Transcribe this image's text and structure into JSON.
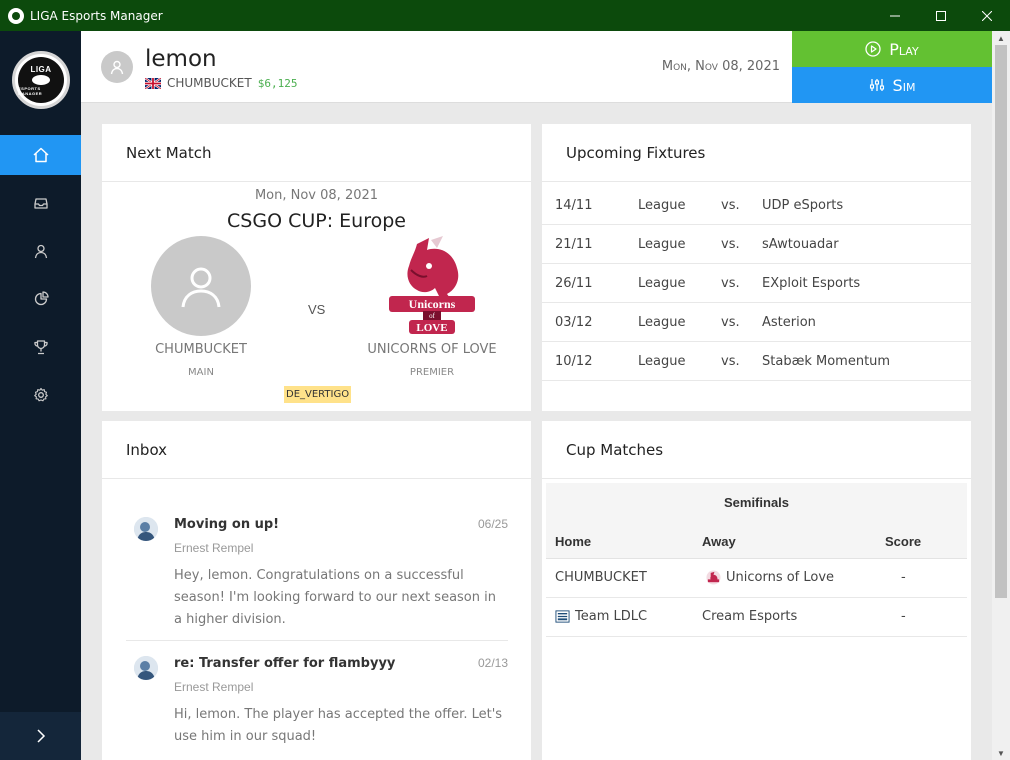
{
  "window": {
    "title": "LIGA Esports Manager"
  },
  "logo": {
    "top_text": "LIGA",
    "bottom_text": "ESPORTS MANAGER"
  },
  "header": {
    "username": "lemon",
    "team": "CHUMBUCKET",
    "money": "$6,125",
    "date": "Mon, Nov 08, 2021",
    "play_label": "Play",
    "sim_label": "Sim"
  },
  "sidebar": {
    "items": [
      {
        "icon": "home-icon",
        "active": true
      },
      {
        "icon": "inbox-icon",
        "active": false
      },
      {
        "icon": "user-icon",
        "active": false
      },
      {
        "icon": "pie-chart-icon",
        "active": false
      },
      {
        "icon": "trophy-icon",
        "active": false
      },
      {
        "icon": "gear-icon",
        "active": false
      }
    ]
  },
  "next_match": {
    "title": "Next Match",
    "date": "Mon, Nov 08, 2021",
    "competition": "CSGO CUP: Europe",
    "home": {
      "name": "CHUMBUCKET",
      "tier": "MAIN"
    },
    "vs": "VS",
    "away": {
      "name": "UNICORNS OF LOVE",
      "tier": "PREMIER",
      "logo_text_top": "Unicorns",
      "logo_text_mid": "of",
      "logo_text_bottom": "LOVE"
    },
    "map": "DE_VERTIGO"
  },
  "fixtures": {
    "title": "Upcoming Fixtures",
    "rows": [
      {
        "date": "14/11",
        "comp": "League",
        "vs": "vs.",
        "opponent": "UDP eSports"
      },
      {
        "date": "21/11",
        "comp": "League",
        "vs": "vs.",
        "opponent": "sAwtouadar"
      },
      {
        "date": "26/11",
        "comp": "League",
        "vs": "vs.",
        "opponent": "EXploit Esports"
      },
      {
        "date": "03/12",
        "comp": "League",
        "vs": "vs.",
        "opponent": "Asterion"
      },
      {
        "date": "10/12",
        "comp": "League",
        "vs": "vs.",
        "opponent": "Stabæk Momentum"
      }
    ]
  },
  "inbox": {
    "title": "Inbox",
    "messages": [
      {
        "subject": "Moving on up!",
        "from": "Ernest Rempel",
        "date": "06/25",
        "body": "Hey, lemon. Congratulations on a successful season! I'm looking forward to our next season in a higher division."
      },
      {
        "subject": "re: Transfer offer for flambyyy",
        "from": "Ernest Rempel",
        "date": "02/13",
        "body": "Hi, lemon. The player has accepted the offer. Let's use him in our squad!"
      }
    ]
  },
  "cup": {
    "title": "Cup Matches",
    "round": "Semifinals",
    "headers": {
      "home": "Home",
      "away": "Away",
      "score": "Score"
    },
    "rows": [
      {
        "home": "CHUMBUCKET",
        "away": "Unicorns of Love",
        "score": "-"
      },
      {
        "home": "Team LDLC",
        "away": "Cream Esports",
        "score": "-"
      }
    ]
  },
  "colors": {
    "titlebar": "#0c4a0c",
    "sidebar": "#0d1b2a",
    "active": "#2196f3",
    "play": "#63c132",
    "sim": "#2196f3",
    "money": "#4caf50"
  }
}
